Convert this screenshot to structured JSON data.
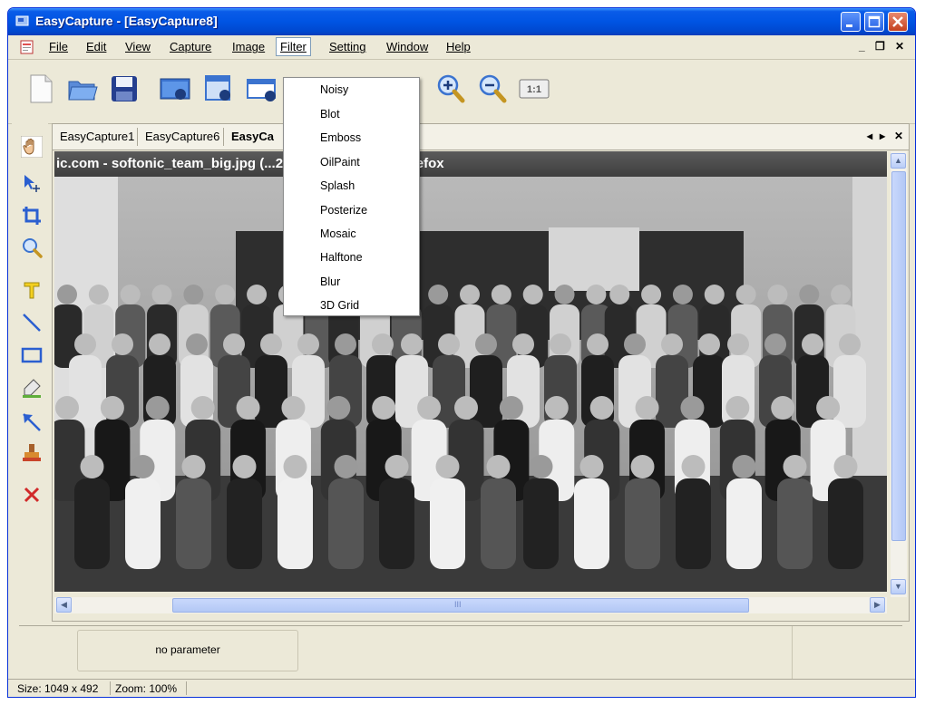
{
  "window": {
    "title": "EasyCapture - [EasyCapture8]"
  },
  "menu": {
    "items": [
      "File",
      "Edit",
      "View",
      "Capture",
      "Image",
      "Filter",
      "Setting",
      "Window",
      "Help"
    ],
    "active": "Filter"
  },
  "mdi_controls": {
    "minimize": "_",
    "restore": "❐",
    "close": "✕"
  },
  "toolbar": {
    "icons": [
      "new-file-icon",
      "open-folder-icon",
      "save-disk-icon",
      "capture-screen-icon",
      "capture-window-icon",
      "capture-region-icon",
      "zoom-in-icon",
      "zoom-out-icon",
      "actual-size-icon"
    ],
    "actual_size_label": "1:1"
  },
  "left_tools": [
    "hand-icon",
    "select-move-icon",
    "crop-icon",
    "zoom-icon",
    "text-icon",
    "line-icon",
    "rectangle-icon",
    "highlighter-icon",
    "arrow-icon",
    "stamp-icon",
    "delete-icon"
  ],
  "tabs": {
    "items": [
      "EasyCapture1",
      "EasyCapture6",
      "EasyCa"
    ],
    "active_index": 2,
    "controls": {
      "prev": "◂",
      "next": "▸",
      "close": "✕"
    }
  },
  "inner_title": "ic.com - softonic_team_big.jpg (...21 pixels) - Mozilla Firefox",
  "filter_menu": [
    "Noisy",
    "Blot",
    "Emboss",
    "OilPaint",
    "Splash",
    "Posterize",
    "Mosaic",
    "Halftone",
    "Blur",
    "3D Grid"
  ],
  "params": {
    "label": "no parameter"
  },
  "status": {
    "size": "Size: 1049 x 492",
    "zoom": "Zoom: 100%"
  },
  "scrollbar": {
    "grip": "III"
  },
  "colors": {
    "title_blue": "#0054e3",
    "chrome": "#ece9d8",
    "scroll_thumb": "#b3c8f5",
    "close_red": "#c4411f"
  }
}
